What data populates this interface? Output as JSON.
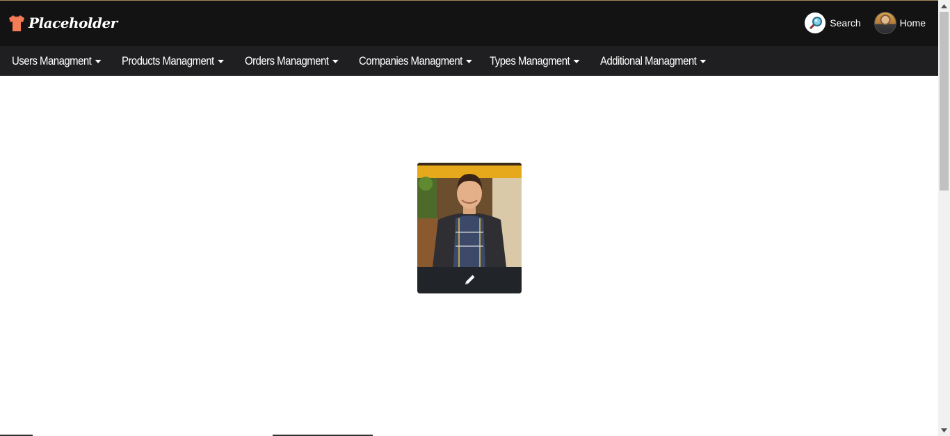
{
  "brand": {
    "name": "Placeholder",
    "logo_icon": "tshirt-icon",
    "logo_color": "#f47c57"
  },
  "header": {
    "search_label": "Search",
    "search_icon": "magnifier-icon",
    "home_label": "Home",
    "home_icon": "user-avatar"
  },
  "nav": {
    "items": [
      {
        "label": "Users Managment"
      },
      {
        "label": "Products Managment"
      },
      {
        "label": "Orders Managment"
      },
      {
        "label": "Companies Managment"
      },
      {
        "label": "Types Managment"
      },
      {
        "label": "Additional Managment"
      }
    ]
  },
  "profile_card": {
    "edit_icon": "pencil-icon"
  },
  "colors": {
    "header_bg": "#131313",
    "nav_bg": "#1f1f21",
    "card_bar": "#212529"
  }
}
